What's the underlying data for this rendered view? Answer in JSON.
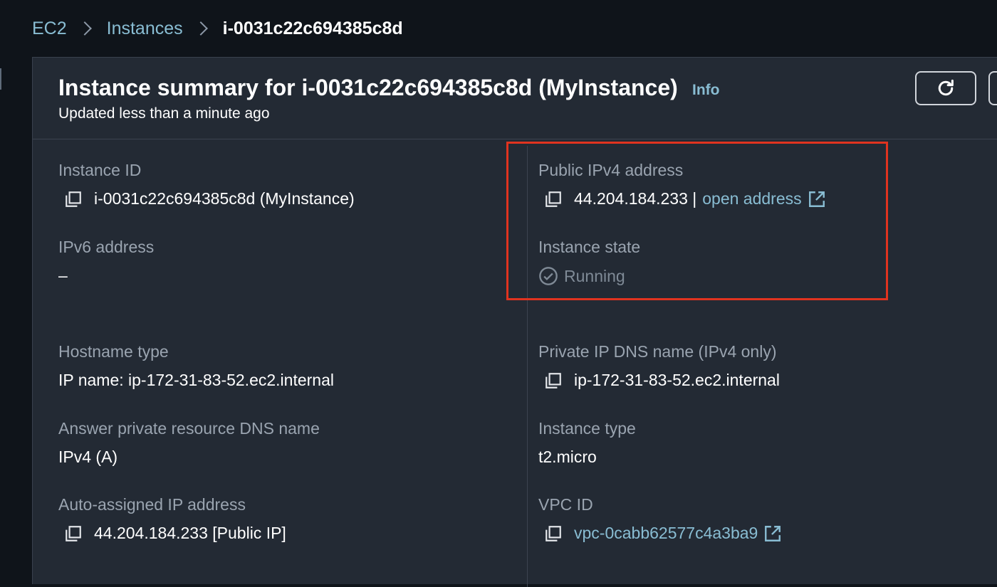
{
  "breadcrumb": {
    "items": [
      "EC2",
      "Instances"
    ],
    "current": "i-0031c22c694385c8d"
  },
  "header": {
    "title": "Instance summary for i-0031c22c694385c8d (MyInstance)",
    "info_label": "Info",
    "subtitle": "Updated less than a minute ago"
  },
  "fields": {
    "instance_id": {
      "label": "Instance ID",
      "value": "i-0031c22c694385c8d (MyInstance)"
    },
    "public_ipv4": {
      "label": "Public IPv4 address",
      "value": "44.204.184.233 |",
      "link": "open address"
    },
    "ipv6": {
      "label": "IPv6 address",
      "value": "–"
    },
    "instance_state": {
      "label": "Instance state",
      "value": "Running"
    },
    "hostname_type": {
      "label": "Hostname type",
      "value": "IP name: ip-172-31-83-52.ec2.internal"
    },
    "private_dns": {
      "label": "Private IP DNS name (IPv4 only)",
      "value": "ip-172-31-83-52.ec2.internal"
    },
    "answer_dns": {
      "label": "Answer private resource DNS name",
      "value": "IPv4 (A)"
    },
    "instance_type": {
      "label": "Instance type",
      "value": "t2.micro"
    },
    "auto_ip": {
      "label": "Auto-assigned IP address",
      "value": "44.204.184.233 [Public IP]"
    },
    "vpc_id": {
      "label": "VPC ID",
      "value": "vpc-0cabb62577c4a3ba9"
    }
  },
  "colors": {
    "background": "#0f141a",
    "panel": "#232a34",
    "link": "#89bdd3",
    "highlight": "#e0331f"
  },
  "icons": {
    "copy": "copy-icon",
    "external": "external-link-icon",
    "refresh": "refresh-icon",
    "status": "check-circle-icon"
  }
}
